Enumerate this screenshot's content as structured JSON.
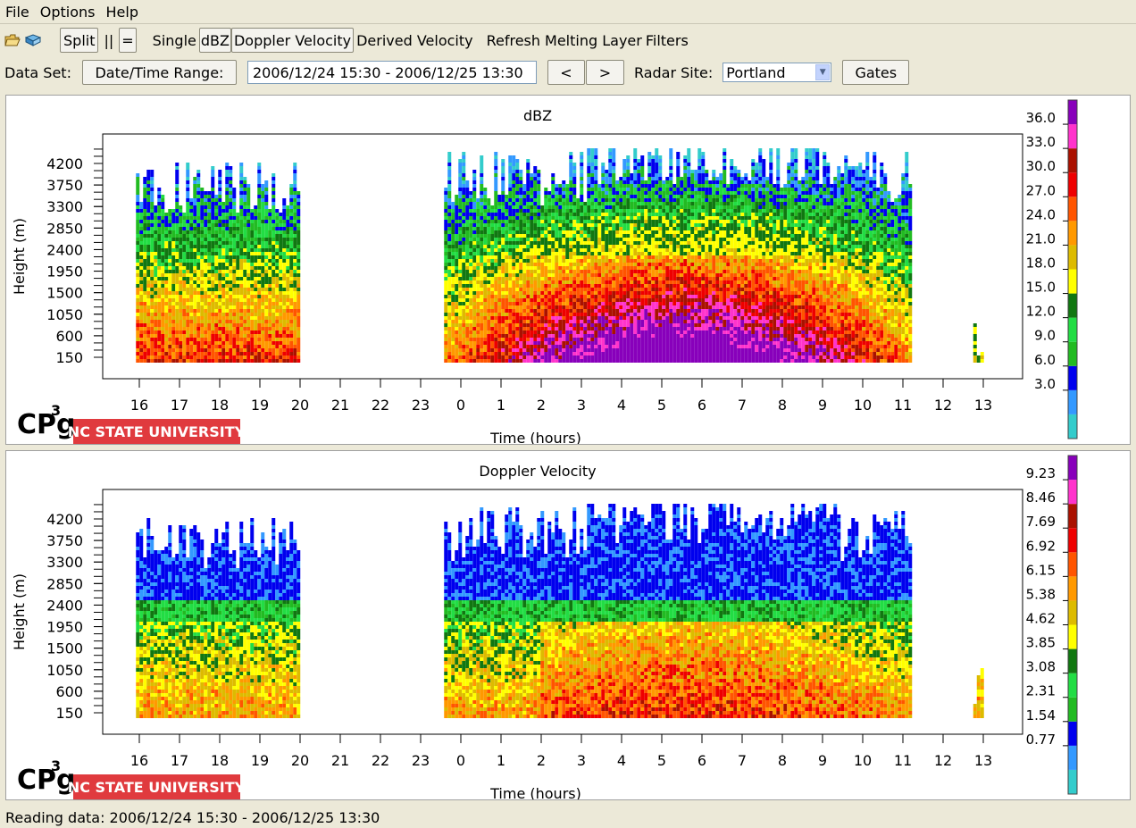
{
  "menu": {
    "file": "File",
    "options": "Options",
    "help": "Help"
  },
  "toolbar": {
    "icons": [
      "open-folder-icon",
      "open-book-icon"
    ],
    "split": "Split",
    "vertical_layout": "||",
    "horizontal_layout": "=",
    "single": "Single",
    "dbz": "dBZ",
    "doppler_velocity": "Doppler Velocity",
    "derived_velocity": "Derived Velocity",
    "refresh": "Refresh",
    "melting_layer": "Melting Layer",
    "filters": "Filters"
  },
  "controls": {
    "data_set_label": "Data Set:",
    "date_time_range_button": "Date/Time Range:",
    "date_time_range_value": "2006/12/24 15:30 - 2006/12/25 13:30",
    "prev_button": "<",
    "next_button": ">",
    "radar_site_label": "Radar Site:",
    "radar_site_value": "Portland",
    "gates_button": "Gates"
  },
  "panels": [
    {
      "logo_text": "CPg",
      "logo_sup": "3",
      "brand_text": "NC STATE UNIVERSITY",
      "brand_color": "#e03a3e"
    },
    {
      "logo_text": "CPg",
      "logo_sup": "3",
      "brand_text": "NC STATE UNIVERSITY",
      "brand_color": "#e03a3e"
    }
  ],
  "chart_data": [
    {
      "type": "heatmap",
      "title": "dBZ",
      "xlabel": "Time (hours)",
      "ylabel": "Height (m)",
      "x_ticks": [
        "16",
        "17",
        "18",
        "19",
        "20",
        "21",
        "22",
        "23",
        "0",
        "1",
        "2",
        "3",
        "4",
        "5",
        "6",
        "7",
        "8",
        "9",
        "10",
        "11",
        "12",
        "13"
      ],
      "y_ticks": [
        "150",
        "600",
        "1050",
        "1500",
        "1950",
        "2400",
        "2850",
        "3300",
        "3750",
        "4200"
      ],
      "colorbar_ticks": [
        "36.0",
        "33.0",
        "30.0",
        "27.0",
        "24.0",
        "21.0",
        "18.0",
        "15.0",
        "12.0",
        "9.0",
        "6.0",
        "3.0"
      ],
      "colorbar_colors": [
        "#33cccc",
        "#3399ff",
        "#0000ee",
        "#22bb22",
        "#22dd44",
        "#117711",
        "#ffff00",
        "#ddbb00",
        "#ff9900",
        "#ff5500",
        "#ee0000",
        "#aa1100",
        "#ff33cc",
        "#8800bb"
      ],
      "echo_periods": [
        {
          "start": "15:55",
          "end": "19:55",
          "top_m": 4300,
          "peak_dbz": 30
        },
        {
          "start": "23:35",
          "end": "11:10",
          "top_m": 4500,
          "peak_dbz": 36
        },
        {
          "start": "12:45",
          "end": "13:00",
          "top_m": 1300,
          "peak_dbz": 18
        }
      ]
    },
    {
      "type": "heatmap",
      "title": "Doppler Velocity",
      "xlabel": "Time (hours)",
      "ylabel": "Height (m)",
      "x_ticks": [
        "16",
        "17",
        "18",
        "19",
        "20",
        "21",
        "22",
        "23",
        "0",
        "1",
        "2",
        "3",
        "4",
        "5",
        "6",
        "7",
        "8",
        "9",
        "10",
        "11",
        "12",
        "13"
      ],
      "y_ticks": [
        "150",
        "600",
        "1050",
        "1500",
        "1950",
        "2400",
        "2850",
        "3300",
        "3750",
        "4200"
      ],
      "colorbar_ticks": [
        "9.23",
        "8.46",
        "7.69",
        "6.92",
        "6.15",
        "5.38",
        "4.62",
        "3.85",
        "3.08",
        "2.31",
        "1.54",
        "0.77"
      ],
      "colorbar_colors": [
        "#33cccc",
        "#3399ff",
        "#0000ee",
        "#22bb22",
        "#22dd44",
        "#117711",
        "#ffff00",
        "#ddbb00",
        "#ff9900",
        "#ff5500",
        "#ee0000",
        "#aa1100",
        "#ff33cc",
        "#8800bb"
      ],
      "echo_periods": [
        {
          "start": "15:55",
          "end": "19:55",
          "top_m": 4300,
          "peak_ms": 6.15
        },
        {
          "start": "23:35",
          "end": "11:10",
          "top_m": 4500,
          "peak_ms": 7.69
        },
        {
          "start": "12:45",
          "end": "13:00",
          "top_m": 1300,
          "peak_ms": 3.08
        }
      ]
    }
  ],
  "status": "Reading data: 2006/12/24 15:30 - 2006/12/25 13:30"
}
